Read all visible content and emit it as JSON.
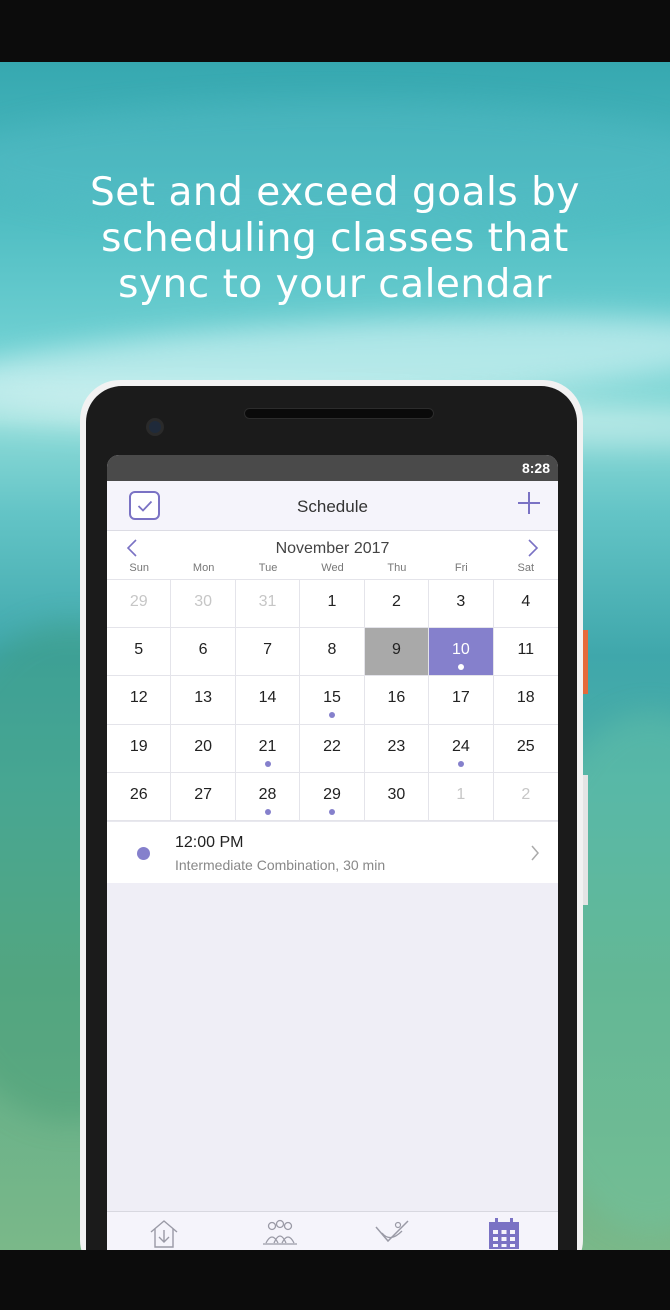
{
  "headline": {
    "line1": "Set and exceed goals by",
    "line2": "scheduling classes that",
    "line3": "sync to your calendar"
  },
  "status_bar": {
    "time": "8:28"
  },
  "app_bar": {
    "title": "Schedule",
    "check_icon": "checkmark-icon",
    "add_icon": "plus-icon"
  },
  "calendar": {
    "month": "November 2017",
    "weekdays": [
      "Sun",
      "Mon",
      "Tue",
      "Wed",
      "Thu",
      "Fri",
      "Sat"
    ],
    "days": [
      {
        "n": "29",
        "muted": true
      },
      {
        "n": "30",
        "muted": true
      },
      {
        "n": "31",
        "muted": true
      },
      {
        "n": "1"
      },
      {
        "n": "2"
      },
      {
        "n": "3"
      },
      {
        "n": "4"
      },
      {
        "n": "5"
      },
      {
        "n": "6"
      },
      {
        "n": "7"
      },
      {
        "n": "8"
      },
      {
        "n": "9",
        "today": true
      },
      {
        "n": "10",
        "selected": true,
        "dot": true
      },
      {
        "n": "11"
      },
      {
        "n": "12"
      },
      {
        "n": "13"
      },
      {
        "n": "14"
      },
      {
        "n": "15",
        "dot": true
      },
      {
        "n": "16"
      },
      {
        "n": "17"
      },
      {
        "n": "18"
      },
      {
        "n": "19"
      },
      {
        "n": "20"
      },
      {
        "n": "21",
        "dot": true
      },
      {
        "n": "22"
      },
      {
        "n": "23"
      },
      {
        "n": "24",
        "dot": true
      },
      {
        "n": "25"
      },
      {
        "n": "26"
      },
      {
        "n": "27"
      },
      {
        "n": "28",
        "dot": true
      },
      {
        "n": "29",
        "dot": true
      },
      {
        "n": "30"
      },
      {
        "n": "1",
        "muted": true
      },
      {
        "n": "2",
        "muted": true
      }
    ]
  },
  "event": {
    "time": "12:00 PM",
    "description": "Intermediate Combination, 30 min"
  },
  "tab_bar": {
    "items": [
      "home-download-icon",
      "group-class-icon",
      "yoga-pose-icon",
      "calendar-icon"
    ],
    "active": "calendar-icon"
  },
  "colors": {
    "accent": "#8580cc",
    "today_gray": "#a9a9a9",
    "status_bar": "#4a4a4a"
  }
}
